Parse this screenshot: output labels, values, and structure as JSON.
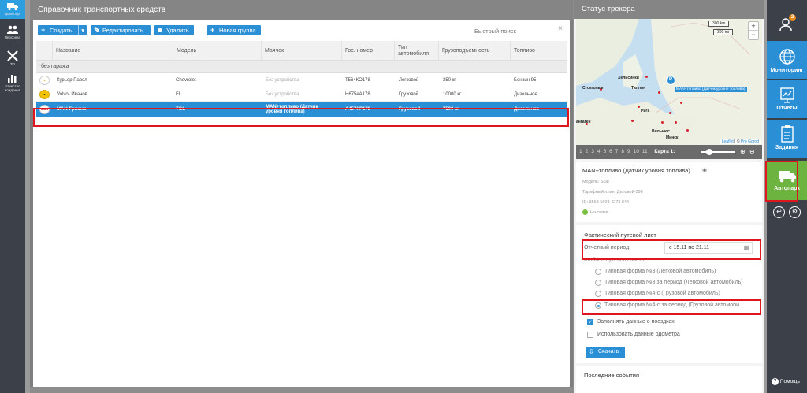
{
  "left_nav": [
    {
      "label": "Транспорт",
      "icon": "truck-icon",
      "active": true
    },
    {
      "label": "Персонал",
      "icon": "people-icon"
    },
    {
      "label": "ТО",
      "icon": "tools-icon"
    },
    {
      "label": "Качество вождения",
      "icon": "bar-chart-icon"
    }
  ],
  "vehicles": {
    "title": "Справочник транспортных средств",
    "toolbar": {
      "create": "Создать",
      "edit": "Редактировать",
      "delete": "Удалить",
      "new_group": "Новая группа"
    },
    "quick_search_placeholder": "Быстрый поиск",
    "columns": [
      "Название",
      "Модель",
      "Маячок",
      "Гос. номер",
      "Тип автомобиля",
      "Грузоподъемность",
      "Топливо"
    ],
    "group": "без гаража",
    "rows": [
      {
        "name": "Курьер Павел",
        "model": "Chevrolet",
        "tracker": "Без устройства",
        "plate": "Т564КО178",
        "type": "Легковой",
        "capacity": "350 кг",
        "fuel": "Бензин 95"
      },
      {
        "name": "Volvo- Иванов",
        "model": "FL",
        "tracker": "Без устройства",
        "plate": "Н675еА178",
        "type": "Грузовой",
        "capacity": "10000 кг",
        "fuel": "Дизельное"
      },
      {
        "name": "MAN-Гришко",
        "model": "TGL",
        "tracker": "MAN+топливо (Датчик уровня топлива)",
        "plate": "А457КР178",
        "type": "Грузовой",
        "capacity": "7500 кг",
        "fuel": "Дизельное",
        "selected": true
      }
    ]
  },
  "status": {
    "title": "Статус трекера",
    "map": {
      "cities": [
        "Хельсинки",
        "Таллин",
        "Стокгольм",
        "Рига",
        "Вильнюс",
        "Минск",
        "ангаген"
      ],
      "label": "MAN+топливо (Датчик уровня топлива)",
      "scale_top": "300 km",
      "scale_bottom": "300 mi",
      "attribution_leaflet": "Leaflet",
      "attribution_sep": " | © ",
      "attribution_provider": "Pro Gorod"
    },
    "pager": {
      "pages": [
        "1",
        "2",
        "3",
        "4",
        "5",
        "6",
        "7",
        "8",
        "9",
        "10",
        "11"
      ],
      "map_label": "Карта 1:"
    },
    "device": {
      "title": "MAN+топливо (Датчик уровня топлива)",
      "model": "Модель: Scat",
      "tariff": "Тарифный план: Деловой-390",
      "id": "ID: 3568 5603 4273 844",
      "online": "На связи",
      "online_color": "#7ac142"
    },
    "waybill": {
      "title": "Фактический путевой лист",
      "period_label": "Отчетный период:",
      "period_value": "с 15.11 по 21.11",
      "template_label": "Шаблон путевого листа:",
      "options": [
        {
          "label": "Типовая форма №3 (Легковой автомобиль)",
          "checked": false
        },
        {
          "label": "Типовая форма №3 за период (Легковой автомобиль)",
          "checked": false
        },
        {
          "label": "Типовая форма №4-с (Грузовой автомобиль)",
          "checked": false
        },
        {
          "label": "Типовая форма №4-с за период (Грузовой автомоби",
          "checked": true
        }
      ],
      "fill_trips": "Заполнять данные о поездках",
      "fill_trips_checked": true,
      "use_odometer": "Использовать данные одометра",
      "use_odometer_checked": false,
      "download": "Скачать"
    },
    "events_title": "Последние события"
  },
  "right_nav": [
    {
      "label": "",
      "icon": "user-icon",
      "badge": "2"
    },
    {
      "label": "Мониторинг",
      "icon": "globe-icon"
    },
    {
      "label": "Отчеты",
      "icon": "report-icon"
    },
    {
      "label": "Задания",
      "icon": "clipboard-icon"
    },
    {
      "label": "Автопарк",
      "icon": "fleet-truck-icon",
      "active": true
    }
  ],
  "help_label": "Помощь",
  "accent_color": "#2b8fd6",
  "active_green": "#6cb33f",
  "highlight_color": "#e0161e"
}
